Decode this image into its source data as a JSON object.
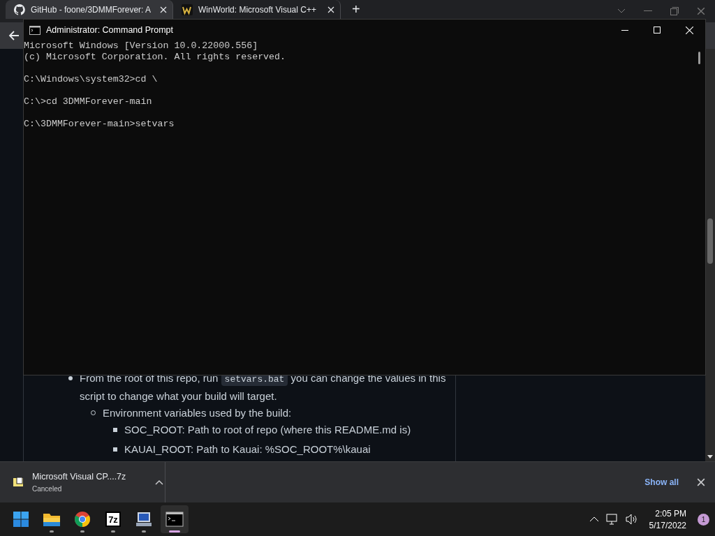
{
  "browser": {
    "tabs": [
      {
        "title": "GitHub - foone/3DMMForever: A",
        "selected": true
      },
      {
        "title": "WinWorld: Microsoft Visual C++",
        "selected": false
      }
    ],
    "new_tab": "+",
    "readme": {
      "item": {
        "before": "From the root of this repo, run ",
        "code": "setvars.bat",
        "after": " you can change the values in this script to change what your build will target."
      },
      "subitem": "Environment variables used by the build:",
      "subsubitems": [
        "SOC_ROOT: Path to root of repo (where this README.md is)",
        "KAUAI_ROOT: Path to Kauai: %SOC_ROOT%\\kauai"
      ]
    },
    "download": {
      "file": "Microsoft Visual CP....7z",
      "status": "Canceled",
      "show_all": "Show all"
    }
  },
  "console_window": {
    "title": "Administrator: Command Prompt",
    "paragraphs": [
      [
        "Microsoft Windows [Version 10.0.22000.556]",
        "(c) Microsoft Corporation. All rights reserved."
      ],
      [
        "C:\\Windows\\system32>cd \\"
      ],
      [
        "C:\\>cd 3DMMForever-main"
      ],
      [
        "C:\\3DMMForever-main>setvars"
      ]
    ]
  },
  "taskbar": {
    "apps": [
      {
        "kind": "start",
        "selected": false
      },
      {
        "kind": "folder",
        "running": true,
        "selected": false
      },
      {
        "kind": "chrome",
        "running": true,
        "selected": false
      },
      {
        "kind": "archive",
        "label": "7z",
        "running": true,
        "selected": false
      },
      {
        "kind": "computer",
        "running": true,
        "selected": false
      },
      {
        "kind": "console",
        "running": true,
        "selected": true
      }
    ],
    "time": "2:05 PM",
    "date": "5/17/2022",
    "notifications": "1"
  }
}
